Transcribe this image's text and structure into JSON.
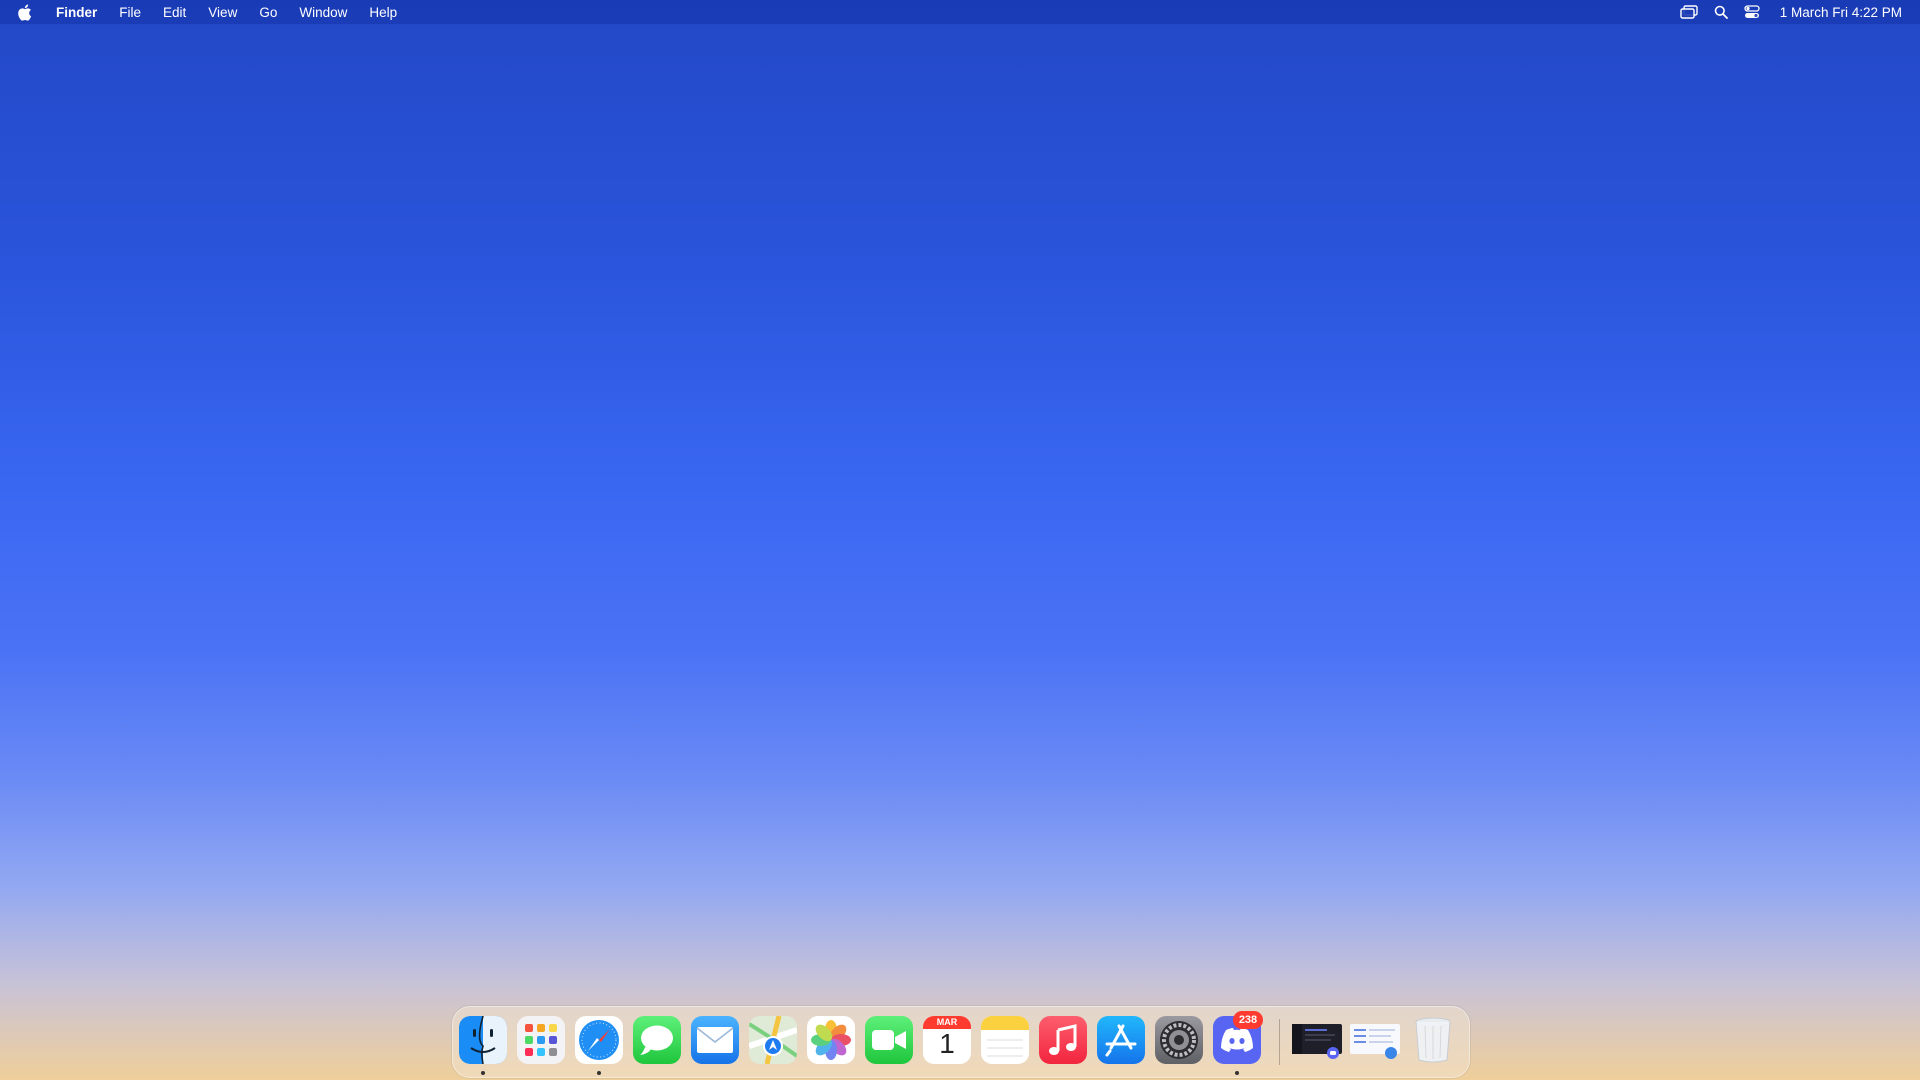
{
  "menubar": {
    "app_name": "Finder",
    "menus": [
      "File",
      "Edit",
      "View",
      "Go",
      "Window",
      "Help"
    ],
    "clock": "1 March Fri  4:22 PM",
    "status_icons": [
      "screen-mirroring-icon",
      "search-icon",
      "control-center-icon"
    ]
  },
  "dock": {
    "apps": [
      {
        "name": "Finder",
        "icon": "finder-icon",
        "running": true
      },
      {
        "name": "Launchpad",
        "icon": "launchpad-icon",
        "running": false
      },
      {
        "name": "Safari",
        "icon": "safari-icon",
        "running": true
      },
      {
        "name": "Messages",
        "icon": "messages-icon",
        "running": false
      },
      {
        "name": "Mail",
        "icon": "mail-icon",
        "running": false
      },
      {
        "name": "Maps",
        "icon": "maps-icon",
        "running": false
      },
      {
        "name": "Photos",
        "icon": "photos-icon",
        "running": false
      },
      {
        "name": "FaceTime",
        "icon": "facetime-icon",
        "running": false
      },
      {
        "name": "Calendar",
        "icon": "calendar-icon",
        "running": false,
        "month": "MAR",
        "day": "1"
      },
      {
        "name": "Notes",
        "icon": "notes-icon",
        "running": false
      },
      {
        "name": "Music",
        "icon": "music-icon",
        "running": false
      },
      {
        "name": "App Store",
        "icon": "app-store-icon",
        "running": false
      },
      {
        "name": "System Settings",
        "icon": "settings-icon",
        "running": false
      },
      {
        "name": "Discord",
        "icon": "discord-icon",
        "running": true,
        "badge": "238"
      }
    ],
    "minimized": [
      "discord-window-thumbnail",
      "document-window-thumbnail"
    ],
    "trash": "trash-icon"
  },
  "colors": {
    "wallpaper_top": "#2348c6",
    "wallpaper_mid": "#3a67f2",
    "wallpaper_bottom": "#efcf9a",
    "badge": "#ff3b30"
  }
}
